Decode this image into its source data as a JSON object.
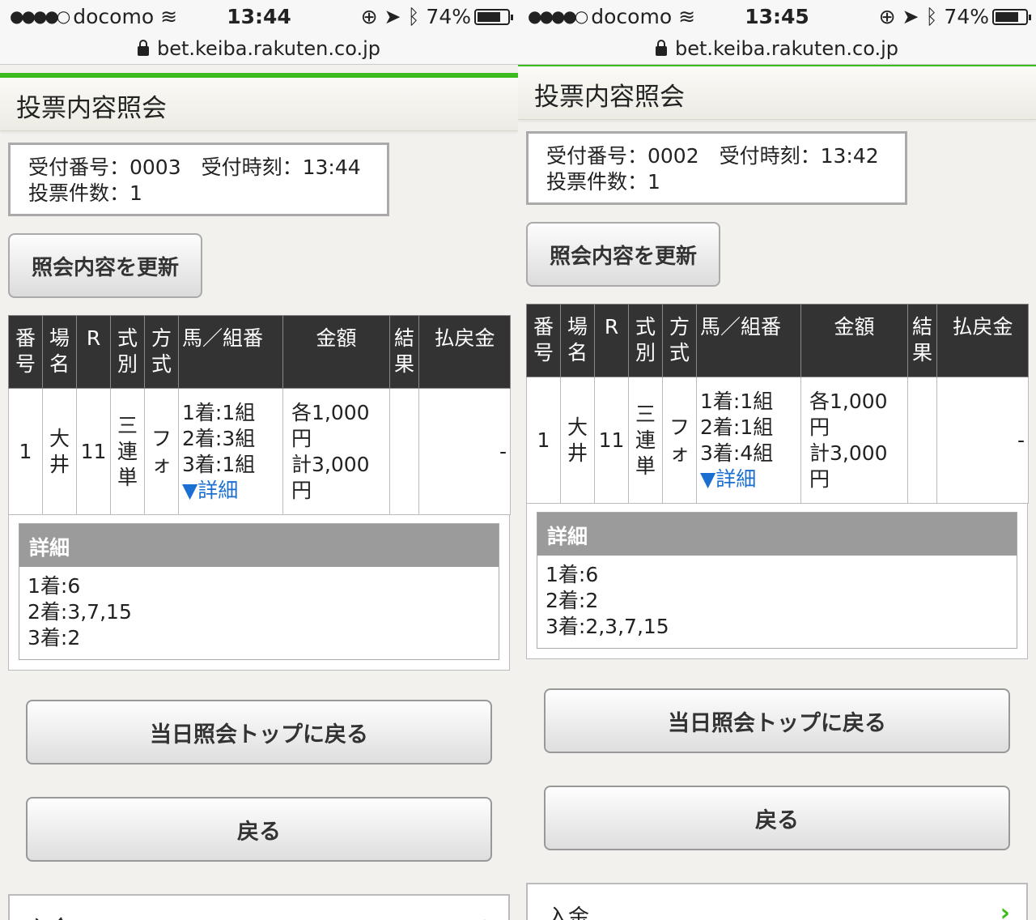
{
  "screens": [
    {
      "status": {
        "carrier": "docomo",
        "time": "13:44",
        "battery": "74%"
      },
      "url": "bet.keiba.rakuten.co.jp",
      "page_title": "投票内容照会",
      "info": {
        "line1": "受付番号：0003　受付時刻：13:44",
        "line2": "投票件数：1"
      },
      "refresh_label": "照会内容を更新",
      "headers": [
        "番号",
        "場名",
        "R",
        "式別",
        "方式",
        "馬／組番",
        "金額",
        "結果",
        "払戻金"
      ],
      "row": {
        "no": "1",
        "venue": "大井",
        "race": "11",
        "type": "三連単",
        "method": "フォ",
        "combo1": "1着:1組",
        "combo2": "2着:3組",
        "combo3": "3着:1組",
        "detail_link": "▼詳細",
        "amount1": "各1,000円",
        "amount2": "計3,000円",
        "result": "",
        "payout": "-"
      },
      "detail": {
        "title": "詳細",
        "line1": "1着:6",
        "line2": "2着:3,7,15",
        "line3": "3着:2"
      },
      "back_top_label": "当日照会トップに戻る",
      "back_label": "戻る",
      "deposit_label": "入金"
    },
    {
      "status": {
        "carrier": "docomo",
        "time": "13:45",
        "battery": "74%"
      },
      "url": "bet.keiba.rakuten.co.jp",
      "page_title": "投票内容照会",
      "info": {
        "line1": "受付番号：0002　受付時刻：13:42",
        "line2": "投票件数：1"
      },
      "refresh_label": "照会内容を更新",
      "headers": [
        "番号",
        "場名",
        "R",
        "式別",
        "方式",
        "馬／組番",
        "金額",
        "結果",
        "払戻金"
      ],
      "row": {
        "no": "1",
        "venue": "大井",
        "race": "11",
        "type": "三連単",
        "method": "フォ",
        "combo1": "1着:1組",
        "combo2": "2着:1組",
        "combo3": "3着:4組",
        "detail_link": "▼詳細",
        "amount1": "各1,000円",
        "amount2": "計3,000円",
        "result": "",
        "payout": "-"
      },
      "detail": {
        "title": "詳細",
        "line1": "1着:6",
        "line2": "2着:2",
        "line3": "3着:2,3,7,15"
      },
      "back_top_label": "当日照会トップに戻る",
      "back_label": "戻る",
      "deposit_label": "入金"
    }
  ],
  "colors": {
    "accent_green": "#3dba1e",
    "table_header": "#333333",
    "detail_header": "#9b9b9b",
    "link": "#1a6fd1"
  }
}
